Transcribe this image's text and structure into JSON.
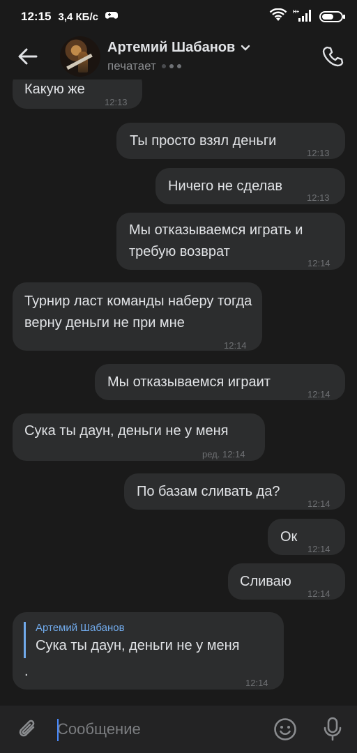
{
  "status_bar": {
    "time": "12:15",
    "speed": "3,4 КБ/с",
    "battery_level": 0.6
  },
  "header": {
    "contact_name": "Артемий Шабанов",
    "status": "печатает",
    "icons": [
      "back-arrow-icon",
      "chevron-down-icon",
      "phone-icon"
    ]
  },
  "messages": [
    {
      "dir": "in",
      "text": "Какую же",
      "time": "12:13"
    },
    {
      "dir": "out",
      "text": "Ты просто взял деньги",
      "time": "12:13"
    },
    {
      "dir": "out",
      "text": "Ничего не сделав",
      "time": "12:13"
    },
    {
      "dir": "out",
      "text": "Мы отказываемся играть и требую возврат",
      "time": "12:14"
    },
    {
      "dir": "in",
      "text": "Турнир ласт команды наберу тогда верну деньги не при мне",
      "time": "12:14"
    },
    {
      "dir": "out",
      "text": "Мы отказываемся играит",
      "time": "12:14"
    },
    {
      "dir": "in",
      "text": "Сука ты даун, деньги не у меня",
      "time": "ред. 12:14"
    },
    {
      "dir": "out",
      "text": "По базам сливать да?",
      "time": "12:14"
    },
    {
      "dir": "out",
      "text": "Ок",
      "time": "12:14"
    },
    {
      "dir": "out",
      "text": "Сливаю",
      "time": "12:14"
    },
    {
      "dir": "in",
      "reply_author": "Артемий Шабанов",
      "reply_text": "Сука ты даун, деньги не у меня",
      "text": ".",
      "time": "12:14"
    }
  ],
  "composer": {
    "placeholder": "Сообщение",
    "icons": [
      "paperclip-icon",
      "emoji-icon",
      "microphone-icon"
    ]
  },
  "colors": {
    "background": "#1a1a1a",
    "bubble": "#2c2d2e",
    "accent": "#71aaeb",
    "time": "#6f7174"
  }
}
